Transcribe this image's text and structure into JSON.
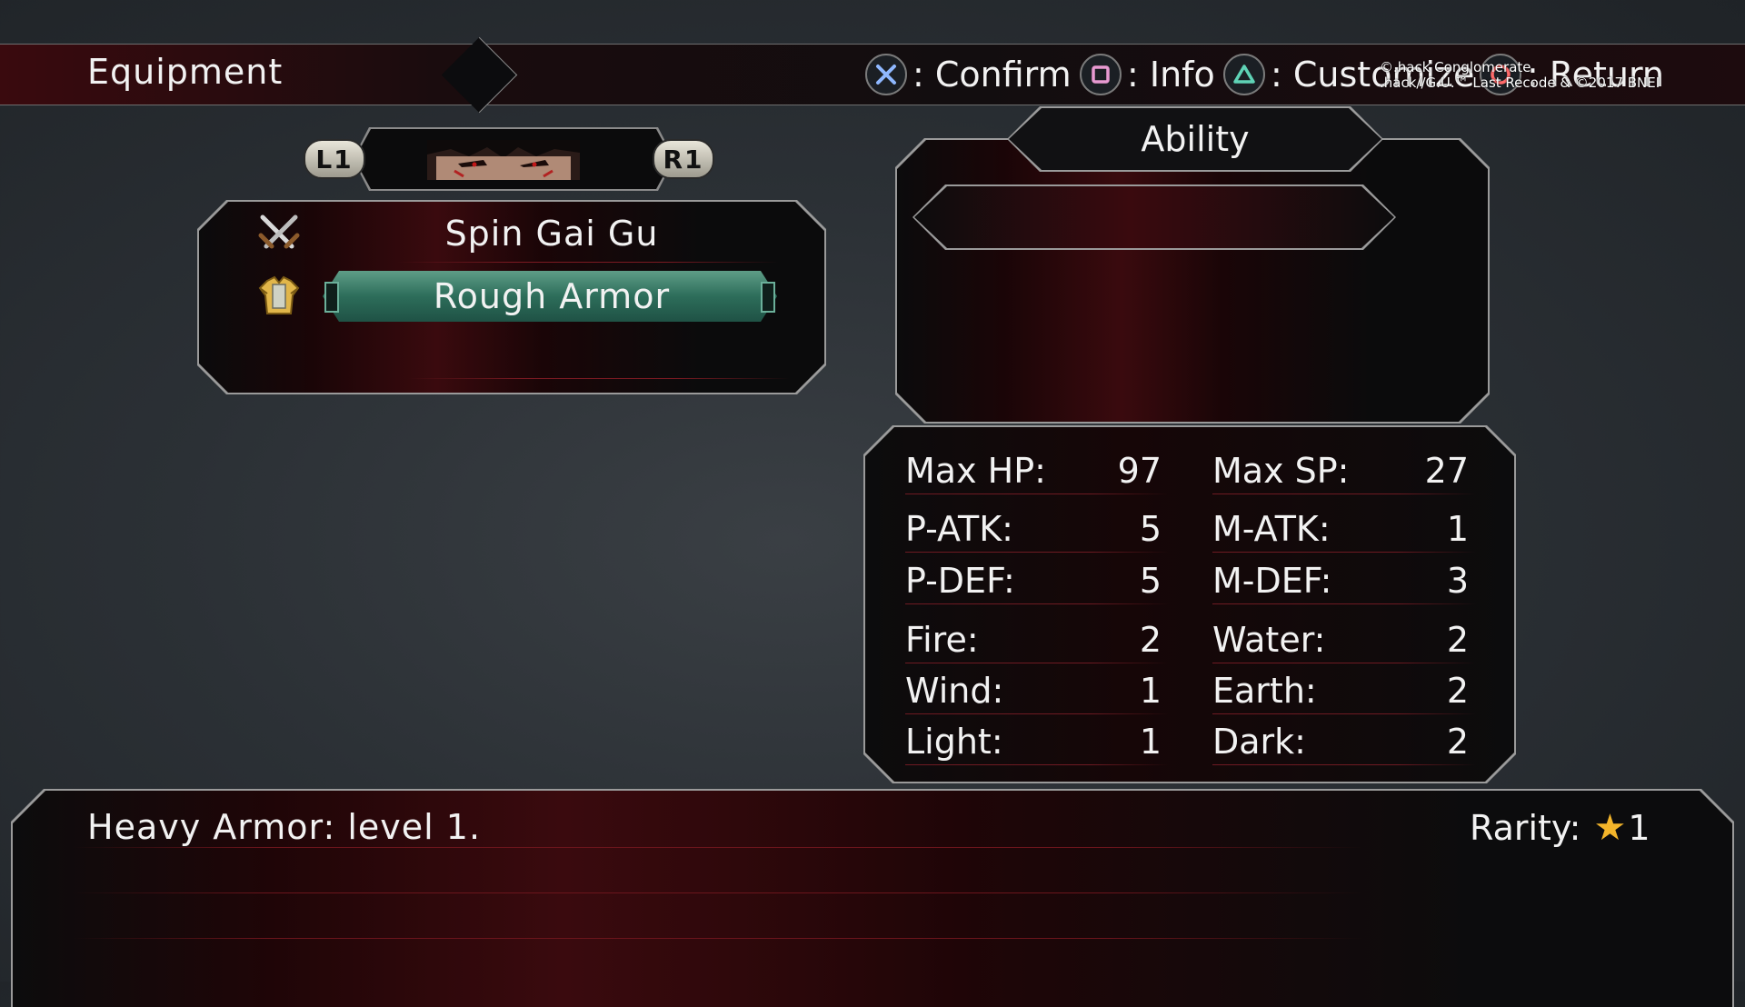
{
  "header": {
    "title": "Equipment",
    "hints": [
      {
        "button": "cross",
        "label": ": Confirm"
      },
      {
        "button": "square",
        "label": ": Info"
      },
      {
        "button": "triangle",
        "label": ": Customize"
      },
      {
        "button": "circle",
        "label": ": Return"
      }
    ],
    "copyright_line1": "©.hack Conglomerate",
    "copyright_line2": ".hack//G.U.™ Last Recode & ©2017 BNEI"
  },
  "character_selector": {
    "prev_button": "L1",
    "next_button": "R1",
    "portrait_icon": "character-portrait"
  },
  "equipment": {
    "weapon": {
      "icon": "crossed-swords-icon",
      "name": "Spin Gai Gu"
    },
    "armor": {
      "icon": "heavy-armor-icon",
      "name": "Rough Armor",
      "selected": true
    },
    "highlight_color": "#2d6d5a"
  },
  "ability": {
    "title": "Ability",
    "slots": [
      ""
    ]
  },
  "stats": {
    "left": [
      {
        "label": "Max HP:",
        "value": "97"
      },
      {
        "label": "P-ATK:",
        "value": "5"
      },
      {
        "label": "P-DEF:",
        "value": "5"
      },
      {
        "label": "Fire:",
        "value": "2"
      },
      {
        "label": "Wind:",
        "value": "1"
      },
      {
        "label": "Light:",
        "value": "1"
      }
    ],
    "right": [
      {
        "label": "Max SP:",
        "value": "27"
      },
      {
        "label": "M-ATK:",
        "value": "1"
      },
      {
        "label": "M-DEF:",
        "value": "3"
      },
      {
        "label": "Water:",
        "value": "2"
      },
      {
        "label": "Earth:",
        "value": "2"
      },
      {
        "label": "Dark:",
        "value": "2"
      }
    ]
  },
  "description": {
    "text": "Heavy Armor: level 1.",
    "rarity_label": "Rarity:",
    "rarity_value": "1",
    "rarity_star_color": "#f3b52a"
  }
}
